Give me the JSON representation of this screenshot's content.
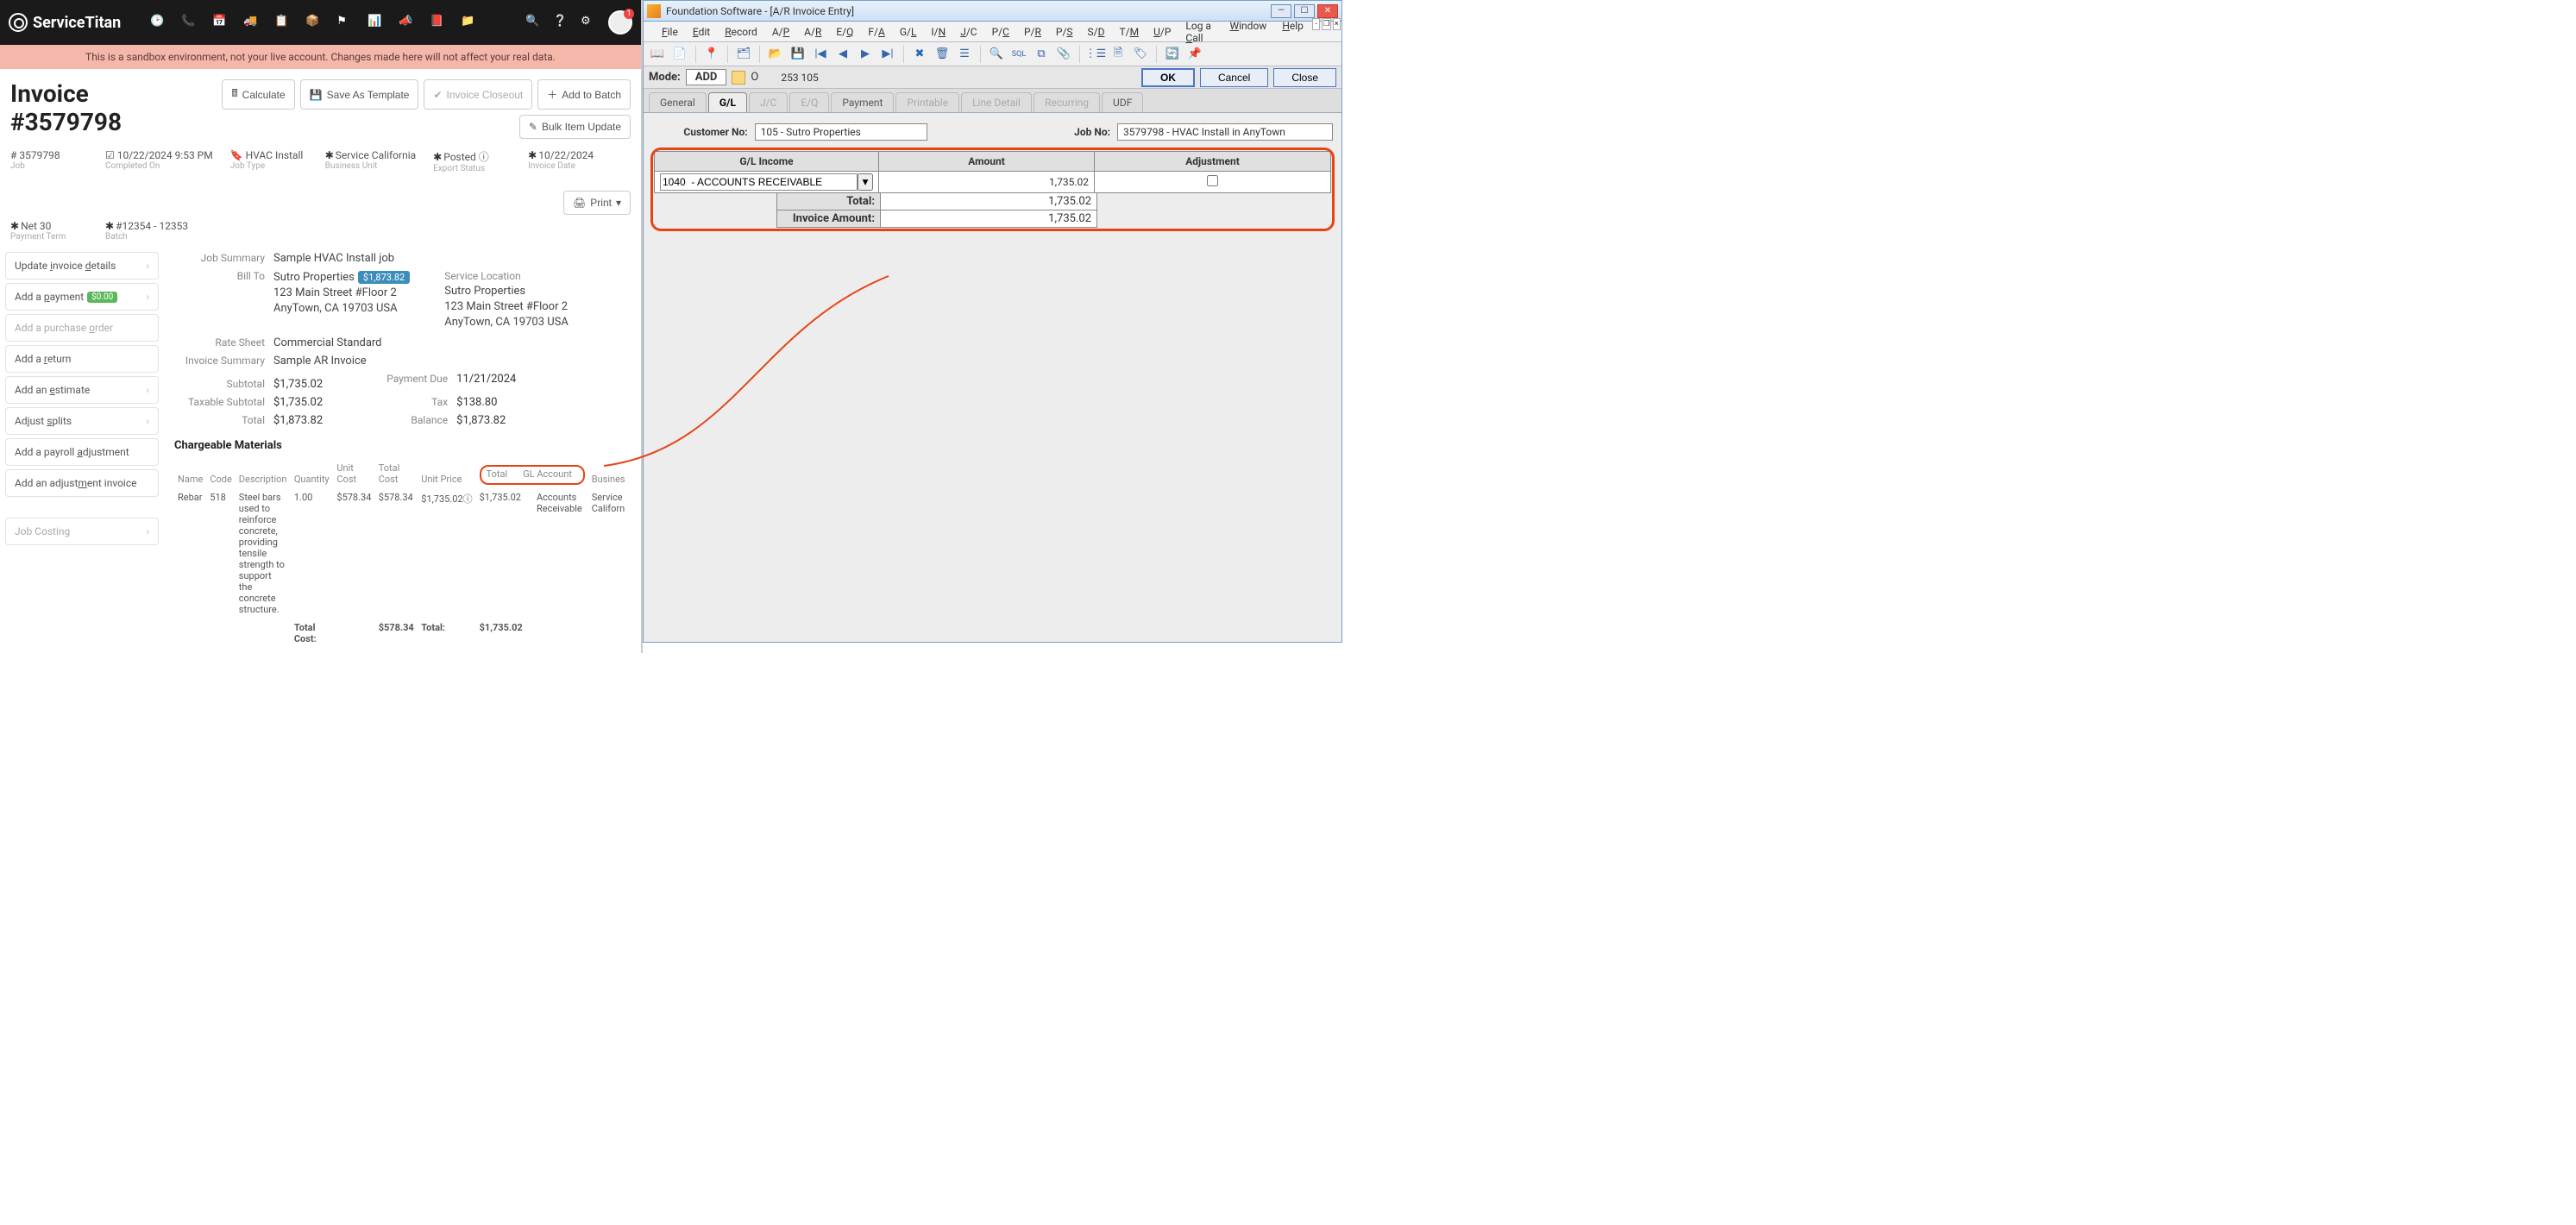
{
  "st": {
    "brand": "ServiceTitan",
    "sandbox_msg": "This is a sandbox environment, not your live account. Changes made here will not affect your real data.",
    "avatar_badge": "1",
    "invoice_title": "Invoice #3579798",
    "header_btns": {
      "calculate": "Calculate",
      "save_template": "Save As Template",
      "closeout": "Invoice Closeout",
      "add_to_batch": "Add to Batch",
      "bulk": "Bulk Item Update",
      "print": "Print"
    },
    "meta": {
      "job_num": "# 3579798",
      "job_num_label": "Job",
      "completed": "10/22/2024 9:53 PM",
      "completed_label": "Completed On",
      "job_type": "HVAC Install",
      "job_type_label": "Job Type",
      "bu": "Service California",
      "bu_label": "Business Unit",
      "export": "Posted",
      "export_label": "Export Status",
      "inv_date": "10/22/2024",
      "inv_date_label": "Invoice Date",
      "pay_term": "Net 30",
      "pay_term_label": "Payment Term",
      "batch": "#12354 - 12353",
      "batch_label": "Batch"
    },
    "actions": {
      "invoice_details": "Update invoice details",
      "payment": "Add a payment",
      "payment_amount": "$0.00",
      "po": "Add a purchase order",
      "return": "Add a return",
      "estimate": "Add an estimate",
      "splits": "Adjust splits",
      "payroll": "Add a payroll adjustment",
      "adj_invoice": "Add an adjustment invoice",
      "job_costing": "Job Costing"
    },
    "summary": {
      "job_summary_label": "Job Summary",
      "job_summary": "Sample HVAC Install job",
      "bill_to_label": "Bill To",
      "bill_to_name": "Sutro Properties",
      "bill_to_badge": "$1,873.82",
      "bill_to_addr1": "123 Main Street #Floor 2",
      "bill_to_addr2": "AnyTown, CA 19703 USA",
      "svc_loc_label": "Service Location",
      "svc_loc_name": "Sutro Properties",
      "svc_loc_addr1": "123 Main Street #Floor 2",
      "svc_loc_addr2": "AnyTown, CA 19703 USA",
      "rate_sheet_label": "Rate Sheet",
      "rate_sheet": "Commercial Standard",
      "inv_summary_label": "Invoice Summary",
      "inv_summary": "Sample AR Invoice",
      "payment_due_label": "Payment Due",
      "payment_due": "11/21/2024",
      "subtotal_label": "Subtotal",
      "subtotal": "$1,735.02",
      "taxable_label": "Taxable Subtotal",
      "taxable": "$1,735.02",
      "total_label": "Total",
      "total": "$1,873.82",
      "tax_label": "Tax",
      "tax": "$138.80",
      "balance_label": "Balance",
      "balance": "$1,873.82"
    },
    "materials": {
      "title": "Chargeable Materials",
      "headers": {
        "name": "Name",
        "code": "Code",
        "desc": "Description",
        "qty": "Quantity",
        "unit_cost": "Unit Cost",
        "total_cost": "Total Cost",
        "unit_price": "Unit Price",
        "total": "Total",
        "gl": "GL Account",
        "bu": "Busines"
      },
      "row": {
        "name": "Rebar",
        "code": "518",
        "desc": "Steel bars used to reinforce concrete, providing tensile strength to support the concrete structure.",
        "qty": "1.00",
        "unit_cost": "$578.34",
        "total_cost": "$578.34",
        "unit_price": "$1,735.02",
        "info": "ⓘ",
        "total": "$1,735.02",
        "gl": "Accounts Receivable",
        "bu": "Service Californ"
      },
      "footer": {
        "total_cost_label": "Total Cost:",
        "total_cost": "$578.34",
        "total_label": "Total:",
        "total": "$1,735.02"
      }
    }
  },
  "fs": {
    "title": "Foundation Software - [A/R Invoice Entry]",
    "menu": [
      "File",
      "Edit",
      "Record",
      "A/P",
      "A/R",
      "E/Q",
      "F/A",
      "G/L",
      "I/N",
      "J/C",
      "P/C",
      "P/R",
      "P/S",
      "S/D",
      "T/M",
      "U/P"
    ],
    "menu_right": [
      "Log a Call",
      "Window",
      "Help"
    ],
    "mode_label": "Mode:",
    "mode_value": "ADD",
    "ctx_o": "O",
    "ctx_nums": "253  105",
    "ok": "OK",
    "cancel": "Cancel",
    "close": "Close",
    "tabs": [
      "General",
      "G/L",
      "J/C",
      "E/Q",
      "Payment",
      "Printable",
      "Line Detail",
      "Recurring",
      "UDF"
    ],
    "active_tab": 1,
    "disabled_tabs": [
      2,
      3,
      5,
      6,
      7
    ],
    "customer_no_label": "Customer No:",
    "customer_no": "105  - Sutro Properties",
    "job_no_label": "Job No:",
    "job_no": "3579798  - HVAC Install in AnyTown",
    "gl_headers": {
      "income": "G/L Income",
      "amount": "Amount",
      "adj": "Adjustment"
    },
    "gl_row": {
      "account": "1040  - ACCOUNTS RECEIVABLE",
      "amount": "1,735.02"
    },
    "gl_total_label": "Total:",
    "gl_total": "1,735.02",
    "gl_invamt_label": "Invoice Amount:",
    "gl_invamt": "1,735.02"
  }
}
